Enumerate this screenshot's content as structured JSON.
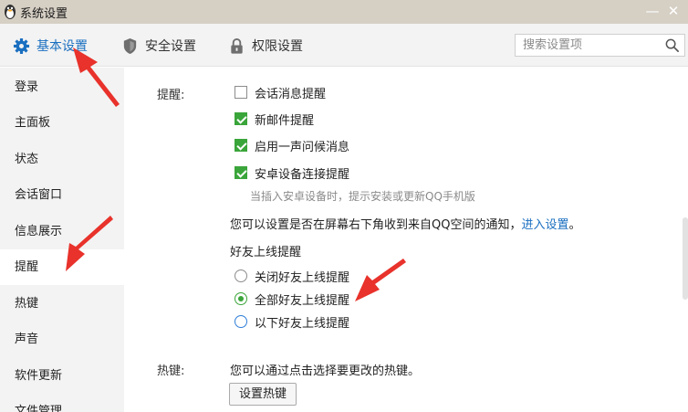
{
  "window": {
    "title": "系统设置",
    "min_glyph": "—",
    "close_glyph": "✕"
  },
  "tabs": [
    {
      "label": "基本设置",
      "icon": "gear-icon",
      "active": true
    },
    {
      "label": "安全设置",
      "icon": "shield-icon",
      "active": false
    },
    {
      "label": "权限设置",
      "icon": "lock-icon",
      "active": false
    }
  ],
  "search": {
    "placeholder": "搜索设置项",
    "value": ""
  },
  "sidebar": {
    "items": [
      {
        "label": "登录"
      },
      {
        "label": "主面板"
      },
      {
        "label": "状态"
      },
      {
        "label": "会话窗口"
      },
      {
        "label": "信息展示"
      },
      {
        "label": "提醒",
        "active": true
      },
      {
        "label": "热键"
      },
      {
        "label": "声音"
      },
      {
        "label": "软件更新"
      },
      {
        "label": "文件管理"
      }
    ]
  },
  "content": {
    "reminder": {
      "label": "提醒:",
      "options": [
        {
          "label": "会话消息提醒",
          "checked": false
        },
        {
          "label": "新邮件提醒",
          "checked": true
        },
        {
          "label": "启用一声问候消息",
          "checked": true
        },
        {
          "label": "安卓设备连接提醒",
          "checked": true
        }
      ],
      "android_hint": "当插入安卓设备时，提示安装或更新QQ手机版",
      "qzone_text": "您可以设置是否在屏幕右下角收到来自QQ空间的通知，",
      "qzone_link": "进入设置",
      "qzone_suffix": "。"
    },
    "friend_online": {
      "title": "好友上线提醒",
      "options": [
        {
          "label": "关闭好友上线提醒",
          "selected": false
        },
        {
          "label": "全部好友上线提醒",
          "selected": true
        },
        {
          "label": "以下好友上线提醒",
          "selected": false
        }
      ]
    },
    "hotkey": {
      "label": "热键:",
      "text": "您可以通过点击选择要更改的热键。",
      "button": "设置热键"
    }
  },
  "colors": {
    "accent": "#1a6fc0",
    "check_green": "#3aa53a",
    "annotation_red": "#e8322b",
    "titlebar": "#d6cfc4"
  }
}
